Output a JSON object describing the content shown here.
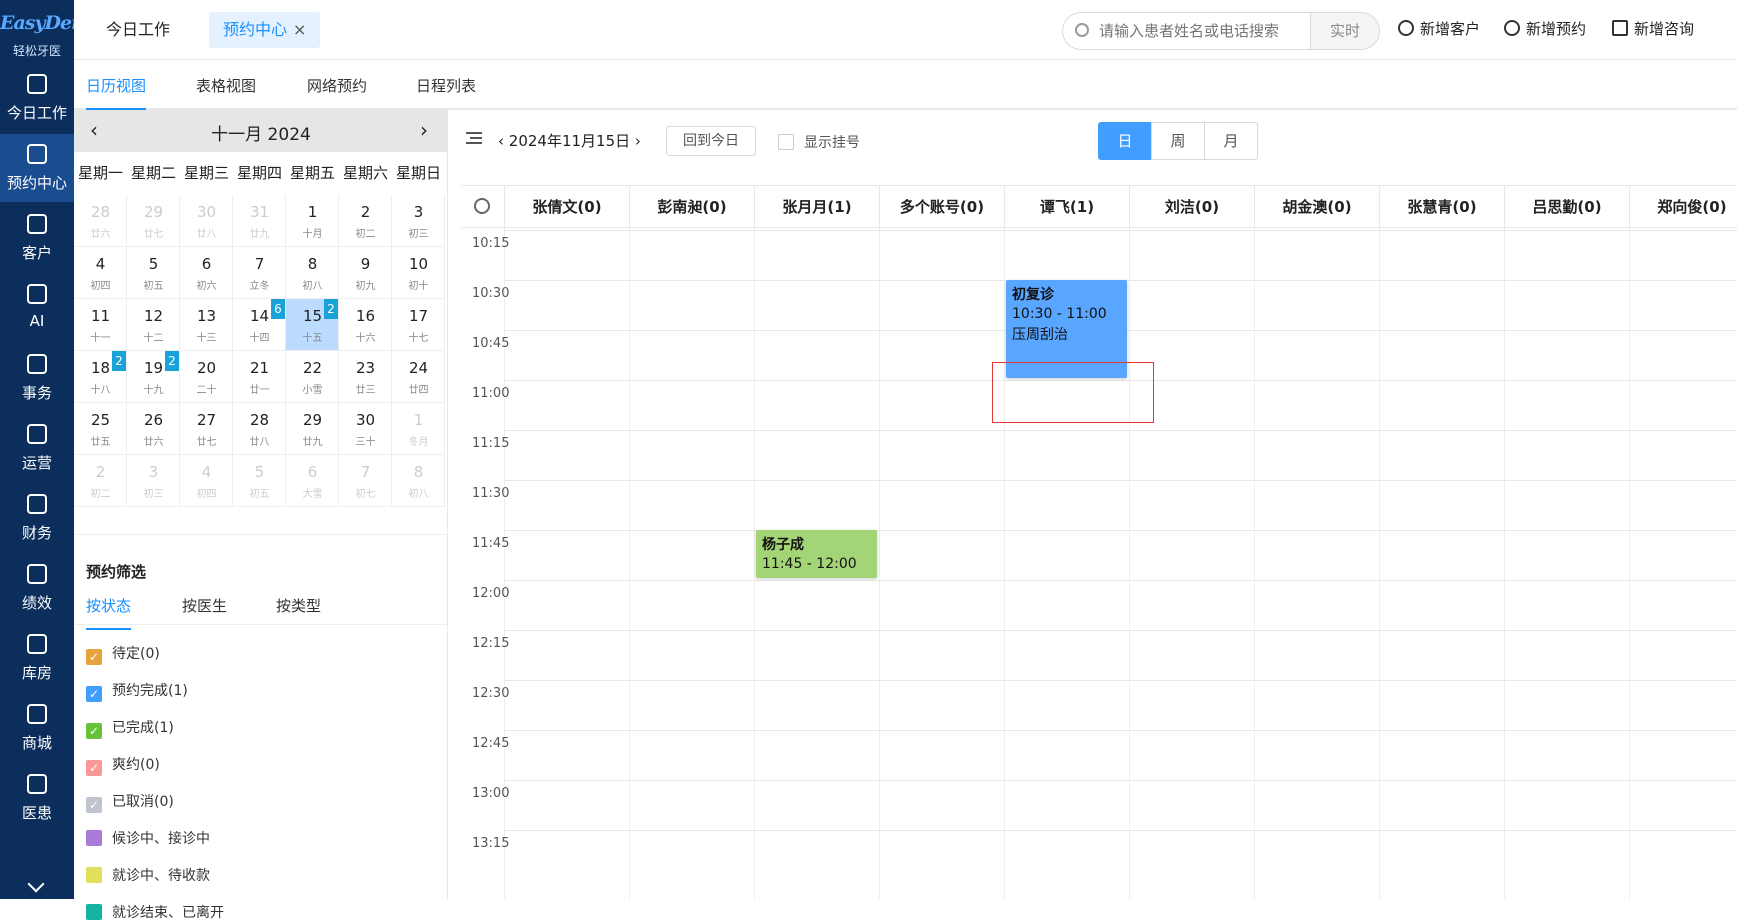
{
  "logo": {
    "brand": "EasyDent",
    "name": "轻松牙医"
  },
  "sidebar": {
    "items": [
      {
        "label": "今日工作",
        "icon": "home-icon"
      },
      {
        "label": "预约中心",
        "icon": "appointment-icon"
      },
      {
        "label": "客户",
        "icon": "user-icon"
      },
      {
        "label": "AI",
        "icon": "ai-chip-icon"
      },
      {
        "label": "事务",
        "icon": "task-icon"
      },
      {
        "label": "运营",
        "icon": "pie-chart-icon"
      },
      {
        "label": "财务",
        "icon": "finance-icon"
      },
      {
        "label": "绩效",
        "icon": "trend-icon"
      },
      {
        "label": "库房",
        "icon": "warehouse-icon"
      },
      {
        "label": "商城",
        "icon": "cart-icon"
      },
      {
        "label": "医患",
        "icon": "people-icon"
      }
    ],
    "active_index": 1
  },
  "topbar": {
    "tabs": [
      {
        "label": "今日工作"
      },
      {
        "label": "预约中心",
        "close": "×"
      }
    ],
    "search_placeholder": "请输入患者姓名或电话搜索",
    "realtime_label": "实时",
    "actions": [
      {
        "label": "新增客户"
      },
      {
        "label": "新增预约"
      },
      {
        "label": "新增咨询"
      }
    ]
  },
  "subtabs": [
    "日历视图",
    "表格视图",
    "网络预约",
    "日程列表"
  ],
  "calendar": {
    "title": "十一月 2024",
    "prev": "‹",
    "next": "›",
    "weekdays": [
      "星期一",
      "星期二",
      "星期三",
      "星期四",
      "星期五",
      "星期六",
      "星期日"
    ],
    "days": [
      {
        "n": "28",
        "s": "廿六",
        "m": true
      },
      {
        "n": "29",
        "s": "廿七",
        "m": true
      },
      {
        "n": "30",
        "s": "廿八",
        "m": true
      },
      {
        "n": "31",
        "s": "廿九",
        "m": true
      },
      {
        "n": "1",
        "s": "十月"
      },
      {
        "n": "2",
        "s": "初二"
      },
      {
        "n": "3",
        "s": "初三"
      },
      {
        "n": "4",
        "s": "初四"
      },
      {
        "n": "5",
        "s": "初五"
      },
      {
        "n": "6",
        "s": "初六"
      },
      {
        "n": "7",
        "s": "立冬"
      },
      {
        "n": "8",
        "s": "初八"
      },
      {
        "n": "9",
        "s": "初九"
      },
      {
        "n": "10",
        "s": "初十"
      },
      {
        "n": "11",
        "s": "十一"
      },
      {
        "n": "12",
        "s": "十二"
      },
      {
        "n": "13",
        "s": "十三"
      },
      {
        "n": "14",
        "s": "十四",
        "b": "6"
      },
      {
        "n": "15",
        "s": "十五",
        "b": "2",
        "sel": true
      },
      {
        "n": "16",
        "s": "十六"
      },
      {
        "n": "17",
        "s": "十七"
      },
      {
        "n": "18",
        "s": "十八",
        "b": "2"
      },
      {
        "n": "19",
        "s": "十九",
        "b": "2"
      },
      {
        "n": "20",
        "s": "二十"
      },
      {
        "n": "21",
        "s": "廿一"
      },
      {
        "n": "22",
        "s": "小雪"
      },
      {
        "n": "23",
        "s": "廿三"
      },
      {
        "n": "24",
        "s": "廿四"
      },
      {
        "n": "25",
        "s": "廿五"
      },
      {
        "n": "26",
        "s": "廿六"
      },
      {
        "n": "27",
        "s": "廿七"
      },
      {
        "n": "28",
        "s": "廿八"
      },
      {
        "n": "29",
        "s": "廿九"
      },
      {
        "n": "30",
        "s": "三十"
      },
      {
        "n": "1",
        "s": "冬月",
        "m": true
      },
      {
        "n": "2",
        "s": "初二",
        "m": true
      },
      {
        "n": "3",
        "s": "初三",
        "m": true
      },
      {
        "n": "4",
        "s": "初四",
        "m": true
      },
      {
        "n": "5",
        "s": "初五",
        "m": true
      },
      {
        "n": "6",
        "s": "大雪",
        "m": true
      },
      {
        "n": "7",
        "s": "初七",
        "m": true
      },
      {
        "n": "8",
        "s": "初八",
        "m": true
      }
    ]
  },
  "filter": {
    "title": "预约筛选",
    "tabs": [
      "按状态",
      "按医生",
      "按类型"
    ],
    "items": [
      {
        "label": "待定(0)",
        "color": "#e6a23c",
        "checked": true
      },
      {
        "label": "预约完成(1)",
        "color": "#409eff",
        "checked": true
      },
      {
        "label": "已完成(1)",
        "color": "#67c23a",
        "checked": true
      },
      {
        "label": "爽约(0)",
        "color": "#f89898",
        "checked": true
      },
      {
        "label": "已取消(0)",
        "color": "#c0c4cc",
        "checked": true
      },
      {
        "label": "候诊中、接诊中",
        "color": "#a97bd6",
        "checked": false
      },
      {
        "label": "就诊中、待收款",
        "color": "#e0e05a",
        "checked": false
      },
      {
        "label": "就诊结束、已离开",
        "color": "#16b4a0",
        "checked": false
      }
    ]
  },
  "toolbar": {
    "date": "2024年11月15日",
    "today_btn": "回到今日",
    "show_reg": "显示挂号",
    "views": [
      "日",
      "周",
      "月"
    ],
    "active_view": 0
  },
  "schedule": {
    "columns": [
      "张倩文(0)",
      "彭南昶(0)",
      "张月月(1)",
      "多个账号(0)",
      "谭飞(1)",
      "刘洁(0)",
      "胡金澳(0)",
      "张慧青(0)",
      "吕思勤(0)",
      "郑向俊(0)"
    ],
    "times": [
      "10:15",
      "10:30",
      "10:45",
      "11:00",
      "11:15",
      "11:30",
      "11:45",
      "12:00",
      "12:15",
      "12:30",
      "12:45",
      "13:00",
      "13:15"
    ],
    "appointments": [
      {
        "col": 4,
        "start": "10:30",
        "end": "11:00",
        "title": "初复诊",
        "time": "10:30 - 11:00",
        "note": "压周刮治",
        "color": "#58a6ff"
      },
      {
        "col": 2,
        "start": "11:45",
        "end": "12:00",
        "title": "杨子成",
        "time": "11:45 - 12:00",
        "note": "",
        "color": "#a3d476"
      }
    ]
  }
}
